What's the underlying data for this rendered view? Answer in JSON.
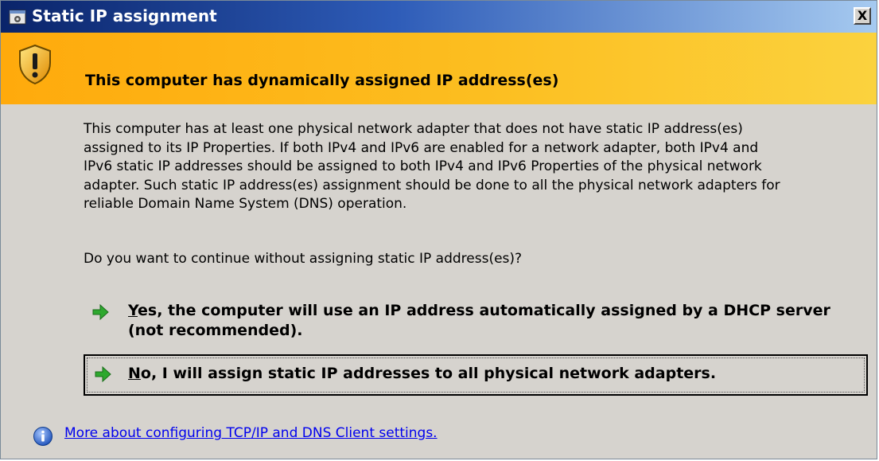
{
  "window": {
    "title": "Static IP assignment",
    "close_label": "X"
  },
  "banner": {
    "icon": "shield-warning-icon",
    "heading": "This computer has dynamically assigned IP address(es)"
  },
  "body": {
    "paragraph_lines": [
      "This computer has at least one physical network adapter that does not have static IP address(es)",
      "assigned to its IP Properties. If both IPv4 and IPv6 are enabled for a network adapter, both IPv4 and",
      "IPv6 static IP addresses should be assigned to both IPv4 and IPv6 Properties of the physical network",
      "adapter. Such static IP address(es) assignment should be done to all the physical network adapters for",
      "reliable Domain Name System (DNS) operation."
    ],
    "question": "Do you want to continue without assigning static IP address(es)?"
  },
  "options": {
    "yes": {
      "accel": "Y",
      "rest": "es, the computer will use an IP address automatically assigned by a DHCP server (not recommended)."
    },
    "no": {
      "accel": "N",
      "rest": "o, I will assign static IP addresses to all physical network adapters."
    }
  },
  "footer": {
    "link_text": "More about configuring TCP/IP and DNS Client settings."
  },
  "colors": {
    "titlebar_start": "#0a246a",
    "banner": "#fcbe20",
    "dialog_bg": "#d6d3ce",
    "arrow": "#2ea82e",
    "link": "#0000ee"
  }
}
